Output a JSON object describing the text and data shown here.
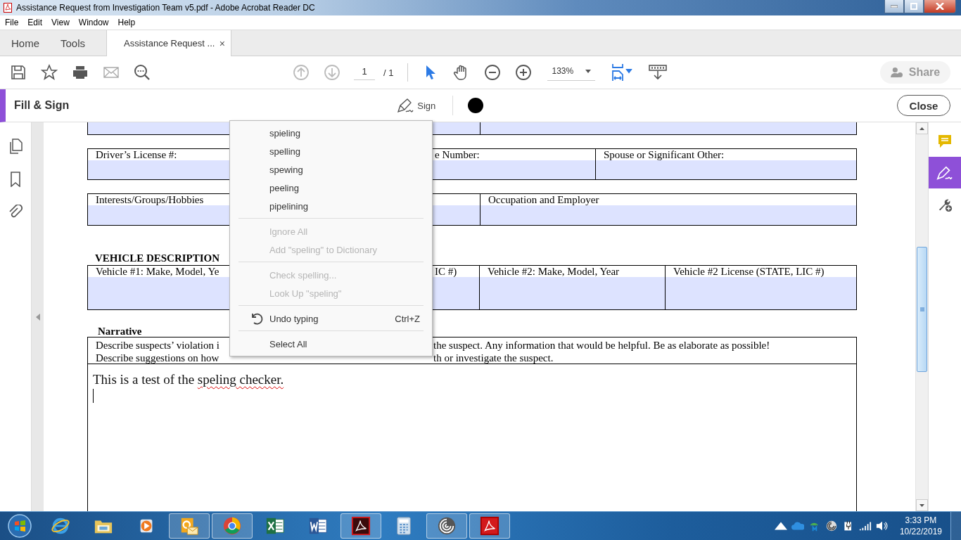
{
  "window": {
    "title": "Assistance Request from Investigation Team v5.pdf - Adobe Acrobat Reader DC"
  },
  "menu_bar": [
    {
      "label": "File"
    },
    {
      "label": "Edit"
    },
    {
      "label": "View"
    },
    {
      "label": "Window"
    },
    {
      "label": "Help"
    }
  ],
  "tabs": [
    {
      "label": "Home",
      "selected": false,
      "kind": "nav"
    },
    {
      "label": "Tools",
      "selected": false,
      "kind": "nav"
    },
    {
      "label": "Assistance Request ...",
      "selected": true,
      "kind": "document",
      "close": "×"
    }
  ],
  "toolbar": {
    "page_current": "1",
    "page_total": "/ 1",
    "zoom": "133%",
    "share": {
      "label": "Share",
      "disabled": true
    }
  },
  "fill_sign": {
    "title": "Fill & Sign",
    "sign": "Sign",
    "close": "Close"
  },
  "document": {
    "tables": [
      {
        "labels": [
          "Driver’s License #:",
          "e Number:",
          "Spouse or Significant Other:"
        ]
      },
      {
        "labels": [
          "Interests/Groups/Hobbies",
          "Occupation and Employer"
        ]
      },
      {
        "heading": "VEHICLE DESCRIPTION",
        "labels": [
          "Vehicle #1: Make, Model, Ye",
          "IC #)",
          "Vehicle #2: Make, Model, Year",
          "Vehicle #2 License (STATE, LIC #)"
        ]
      }
    ],
    "narrative": {
      "heading": "Narrative",
      "left_lines": [
        "Describe suspects’ violation i",
        "Describe suggestions on how"
      ],
      "right_lines": [
        "the suspect.  Any information that would be helpful.  Be as elaborate as possible!",
        "th or investigate the suspect."
      ],
      "typed": [
        {
          "text": "This is a test of the ",
          "misspelled": false
        },
        {
          "text": "speling",
          "misspelled": true
        },
        {
          "text": " checker.",
          "misspelled": true
        }
      ]
    }
  },
  "context_menu": [
    {
      "kind": "item",
      "label": "spieling",
      "disabled": false
    },
    {
      "kind": "item",
      "label": "spelling",
      "disabled": false
    },
    {
      "kind": "item",
      "label": "spewing",
      "disabled": false
    },
    {
      "kind": "item",
      "label": "peeling",
      "disabled": false
    },
    {
      "kind": "item",
      "label": "pipelining",
      "disabled": false
    },
    {
      "kind": "separator"
    },
    {
      "kind": "item",
      "label": "Ignore All",
      "disabled": true
    },
    {
      "kind": "item",
      "label": "Add \"speling\" to Dictionary",
      "disabled": true
    },
    {
      "kind": "separator"
    },
    {
      "kind": "item",
      "label": "Check spelling...",
      "disabled": true
    },
    {
      "kind": "item",
      "label": "Look Up \"speling\"",
      "disabled": true
    },
    {
      "kind": "separator"
    },
    {
      "kind": "undo",
      "label": "Undo typing",
      "disabled": false,
      "shortcut": "Ctrl+Z"
    },
    {
      "kind": "separator"
    },
    {
      "kind": "item",
      "label": "Select All",
      "disabled": false
    }
  ],
  "right_rail": [
    {
      "kind": "comment",
      "selected": false
    },
    {
      "kind": "fill_sign",
      "selected": true
    },
    {
      "kind": "tools",
      "selected": false
    }
  ],
  "taskbar": {
    "apps": [
      {
        "kind": "browser",
        "running": false
      },
      {
        "kind": "folder",
        "running": false
      },
      {
        "kind": "media",
        "running": false
      },
      {
        "kind": "mail",
        "running": true
      },
      {
        "kind": "globe",
        "running": true
      },
      {
        "kind": "sheet",
        "running": false
      },
      {
        "kind": "word",
        "running": false
      },
      {
        "kind": "pdf_dark",
        "running": true
      },
      {
        "kind": "calc",
        "running": false
      },
      {
        "kind": "spiral",
        "running": true
      },
      {
        "kind": "pdf",
        "running": true
      }
    ],
    "clock": {
      "time": "3:33 PM",
      "date": "10/22/2019"
    }
  }
}
